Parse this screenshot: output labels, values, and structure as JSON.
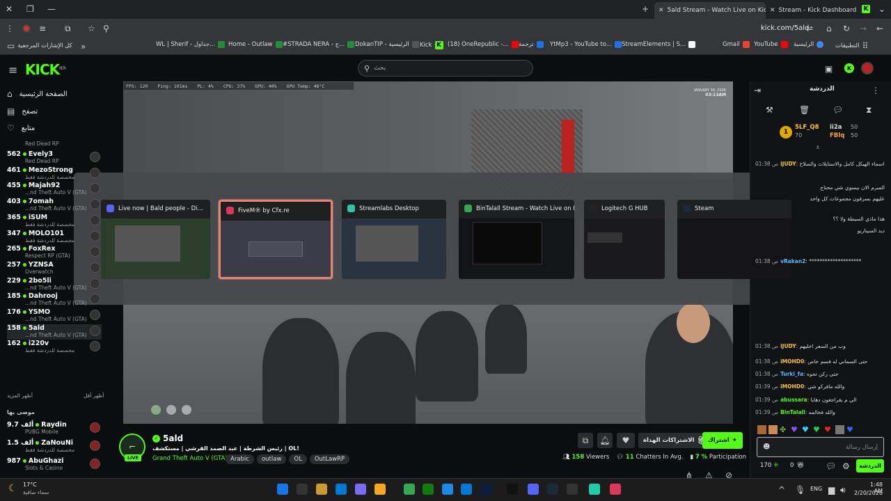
{
  "browser": {
    "tabs": [
      {
        "title": "5ald Stream - Watch Live on Kick",
        "active": true
      },
      {
        "title": "Stream - Kick Dashboard",
        "active": false
      }
    ],
    "url": "kick.com/5ald",
    "bookmarks": [
      "كل الإشارات المرجعية",
      "WL | Sherif - جداول...",
      "Home - Outlaw",
      "#STRADA NERA - ج...",
      "DokanTIP - الرئيسية",
      "Kick",
      "(18) OneRepublic -...",
      "ترجمة",
      "YtMp3 - YouTube to...",
      "StreamElements | S...",
      "Gmail",
      "YouTube",
      "الرئيسية",
      "التطبيقات"
    ]
  },
  "header": {
    "logo": "KICK",
    "logo_badge": "BETA",
    "search_placeholder": "بحث"
  },
  "sidebar": {
    "nav": [
      {
        "label": "الصفحة الرئيسية"
      },
      {
        "label": "تصفح"
      },
      {
        "label": "متابع"
      }
    ],
    "top_game_partial": "Red Dead RP",
    "channels": [
      {
        "viewers": "562",
        "name": "Evely3",
        "game": "Red Dead RP"
      },
      {
        "viewers": "461",
        "name": "MezoStrong",
        "game": "مخصصة للدردشة فقط"
      },
      {
        "viewers": "455",
        "name": "Majah92",
        "game": "...nd Theft Auto V (GTA)"
      },
      {
        "viewers": "403",
        "name": "7omah",
        "game": "...nd Theft Auto V (GTA)"
      },
      {
        "viewers": "365",
        "name": "iSUM",
        "game": "مخصصة للدردشة فقط"
      },
      {
        "viewers": "347",
        "name": "MOLO101",
        "game": "مخصصة للدردشة فقط"
      },
      {
        "viewers": "265",
        "name": "FoxRex",
        "game": "Respect RP (GTA)"
      },
      {
        "viewers": "257",
        "name": "YZNSA",
        "game": "Overwatch"
      },
      {
        "viewers": "229",
        "name": "2bo5li",
        "game": "...nd Theft Auto V (GTA)"
      },
      {
        "viewers": "185",
        "name": "Dahrooj",
        "game": "...nd Theft Auto V (GTA)"
      },
      {
        "viewers": "176",
        "name": "YSMO",
        "game": "...nd Theft Auto V (GTA)"
      },
      {
        "viewers": "158",
        "name": "5ald",
        "game": "...nd Theft Auto V (GTA)"
      },
      {
        "viewers": "162",
        "name": "i220v",
        "game": "مخصصة للدردشة فقط"
      }
    ],
    "show_more": "أظهر المزيد",
    "show_less": "أظهر أقل",
    "recommended_label": "موصى بها",
    "recommended": [
      {
        "viewers": "9.7 ألف",
        "name": "Raydin",
        "game": "PUBG Mobile"
      },
      {
        "viewers": "1.5 ألف",
        "name": "ZaNouNi",
        "game": "مخصصة للدردشة فقط"
      },
      {
        "viewers": "987",
        "name": "AbuGhazi",
        "game": "Slots & Casino"
      }
    ]
  },
  "video": {
    "hud": [
      "FPS: 120",
      "Ping: 101ms",
      "PL: 4%",
      "CPU: 37%",
      "GPU: 40%",
      "GPU Temp: 46°C"
    ],
    "watermark_date": "JANUARY 16, 2026",
    "watermark_time": "03:13AM"
  },
  "switcher": {
    "windows": [
      {
        "title": "Live now | Bald people - Di...",
        "color": "#5865f2"
      },
      {
        "title": "FiveM® by Cfx.re",
        "color": "#d9385f"
      },
      {
        "title": "Streamlabs Desktop",
        "color": "#31c3a2"
      },
      {
        "title": "BinTalall Stream - Watch Live on Ki...",
        "color": "#34a853"
      },
      {
        "title": "Logitech G HUB",
        "color": "#222"
      },
      {
        "title": "Steam",
        "color": "#1b2838"
      }
    ]
  },
  "stream_info": {
    "channel": "5ald",
    "live_badge": "LIVE",
    "title": "رئيس الشرطة | عبد الصمد القرشي | مستكشف | OL!",
    "category": "Grand Theft Auto V (GTA)",
    "tags": [
      "Arabic",
      "outlaw",
      "OL",
      "OutLawRP"
    ],
    "follow_label": "اشتراك",
    "subs_label": "الاشتراكات الهداة",
    "viewers": "158",
    "viewers_label": "Viewers",
    "chatters": "11",
    "chatters_label": "Chatters In Avg.",
    "participation": "7 %",
    "participation_label": "Participation"
  },
  "chat": {
    "header": "الدردشة",
    "leaderboard": [
      {
        "rank": "1",
        "name": "5LF_Q8",
        "points": "70"
      },
      {
        "name": "ii2a",
        "points": "50"
      },
      {
        "name": "FBlq",
        "points": "50"
      }
    ],
    "messages": [
      {
        "time": "01:38 ص",
        "user": "iJUDY",
        "text": "اسماء الهيكل كامل والاستايلات والسلاح",
        "color": "#f5c542"
      },
      {
        "time": "",
        "user": "",
        "text": "المبرم الان ببسوي شي محتاج",
        "color": "#ddd"
      },
      {
        "time": "",
        "user": "",
        "text": "عليهم بسرفون مجموعات كل واحد",
        "color": "#ddd"
      },
      {
        "time": "",
        "user": "",
        "text": "هذا ماذي السبطة ولا ؟؟",
        "color": "#ddd"
      },
      {
        "time": "",
        "user": "",
        "text": "ديد السيناريو",
        "color": "#ddd"
      },
      {
        "time": "01:38 ص",
        "user": "vRakan2",
        "text": "********************",
        "color": "#5fb8ff"
      },
      {
        "time": "01:38 ص",
        "user": "iJUDY",
        "text": "وب من السعر اخليهم",
        "color": "#f5c542"
      },
      {
        "time": "01:38 ص",
        "user": "iMOHD0",
        "text": "حتى السماني له قسم خاص",
        "color": "#f5c542"
      },
      {
        "time": "01:38 ص",
        "user": "Turki_fa",
        "text": "حتى ركن تحوه",
        "color": "#5fb8ff"
      },
      {
        "time": "01:39 ص",
        "user": "iMOHD0",
        "text": "والله مافركو شي",
        "color": "#f5c542"
      },
      {
        "time": "01:39 ص",
        "user": "abussara",
        "text": "الي م يقراجعون دهايا",
        "color": "#53fc18"
      },
      {
        "time": "01:39 ص",
        "user": "BinTalall",
        "text": "والله فخالمه",
        "color": "#53fc18"
      }
    ],
    "input_placeholder": "إرسال رسالة",
    "points": "170",
    "gifts": "0",
    "send_label": "الدردشة"
  },
  "taskbar": {
    "weather_temp": "17°C",
    "weather_text": "سماء صافية",
    "lang": "ENG",
    "time": "1:48 AM",
    "date": "2/20/2026"
  }
}
